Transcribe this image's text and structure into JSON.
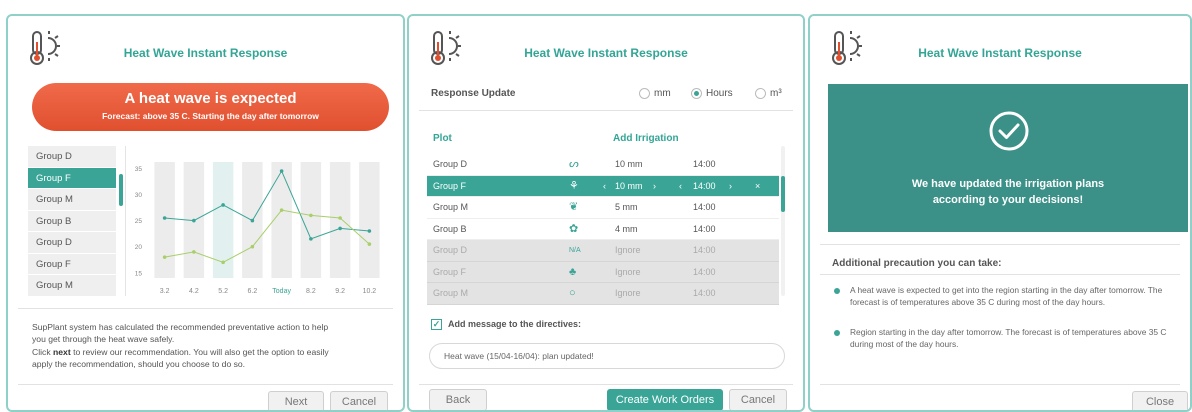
{
  "app_title": "Heat Wave Instant Response",
  "panel1": {
    "alert_title": "A heat wave is expected",
    "alert_subtitle": "Forecast: above 35 C. Starting  the day after tomorrow",
    "groups": [
      "Group D",
      "Group F",
      "Group M",
      "Group B",
      "Group D",
      "Group F",
      "Group M"
    ],
    "selected_group_index": 1,
    "description_line1": "SupPlant system has calculated the recommended preventative action to help",
    "description_line2": "you get through the heat wave safely.",
    "description_line3_pre": "Click ",
    "description_line3_bold": "next",
    "description_line3_post": " to review our recommendation. You will also get the option to easily",
    "description_line4": "apply the recommendation, should you choose to do so.",
    "next_label": "Next",
    "cancel_label": "Cancel"
  },
  "chart_data": {
    "type": "line",
    "categories": [
      "3.2",
      "4.2",
      "5.2",
      "6.2",
      "Today",
      "8.2",
      "9.2",
      "10.2"
    ],
    "yticks": [
      15,
      20,
      25,
      30,
      35
    ],
    "ylim": [
      14,
      37
    ],
    "series": [
      {
        "color": "#3aa597",
        "values": [
          25.5,
          25,
          28,
          25,
          34.5,
          21.5,
          23.5,
          23
        ]
      },
      {
        "color": "#a8cf6a",
        "values": [
          18,
          19,
          17,
          20,
          27,
          26,
          25.5,
          20.5
        ]
      }
    ],
    "highlight_category_index": 2
  },
  "panel2": {
    "response_update_label": "Response Update",
    "units": [
      "mm",
      "Hours",
      "m³"
    ],
    "selected_unit_index": 1,
    "col_plot": "Plot",
    "col_irrigation": "Add Irrigation",
    "rows": [
      {
        "plot": "Group D",
        "icon": "sprout-icon",
        "glyph": "ᔕ",
        "amount": "10 mm",
        "time": "14:00",
        "state": "normal"
      },
      {
        "plot": "Group F",
        "icon": "plant-icon",
        "glyph": "⚘",
        "amount": "10 mm",
        "time": "14:00",
        "state": "selected"
      },
      {
        "plot": "Group M",
        "icon": "herb-icon",
        "glyph": "❦",
        "amount": "5 mm",
        "time": "14:00",
        "state": "normal"
      },
      {
        "plot": "Group B",
        "icon": "fruit-icon",
        "glyph": "✿",
        "amount": "4 mm",
        "time": "14:00",
        "state": "normal"
      },
      {
        "plot": "Group D",
        "icon": "na-icon",
        "glyph": "N/A",
        "amount": "Ignore",
        "time": "14:00",
        "state": "dim"
      },
      {
        "plot": "Group F",
        "icon": "tree-icon",
        "glyph": "♣",
        "amount": "Ignore",
        "time": "14:00",
        "state": "dim"
      },
      {
        "plot": "Group M",
        "icon": "seed-icon",
        "glyph": "○",
        "amount": "Ignore",
        "time": "14:00",
        "state": "dim"
      }
    ],
    "add_message_label": "Add message to the directives:",
    "message_value": "Heat wave (15/04-16/04): plan updated!",
    "back_label": "Back",
    "create_label": "Create Work Orders",
    "cancel_label": "Cancel"
  },
  "panel3": {
    "success_line1": "We have updated the irrigation plans",
    "success_line2": "according to your decisions!",
    "precaution_title": "Additional precaution you can take:",
    "bullets": [
      "A heat wave is expected to get into the region starting in the day after tomorrow. The forecast is of temperatures above 35   C during most of the day hours.",
      "Region starting in the day after tomorrow. The forecast is of temperatures above 35   C during most of the day hours."
    ],
    "close_label": "Close"
  }
}
